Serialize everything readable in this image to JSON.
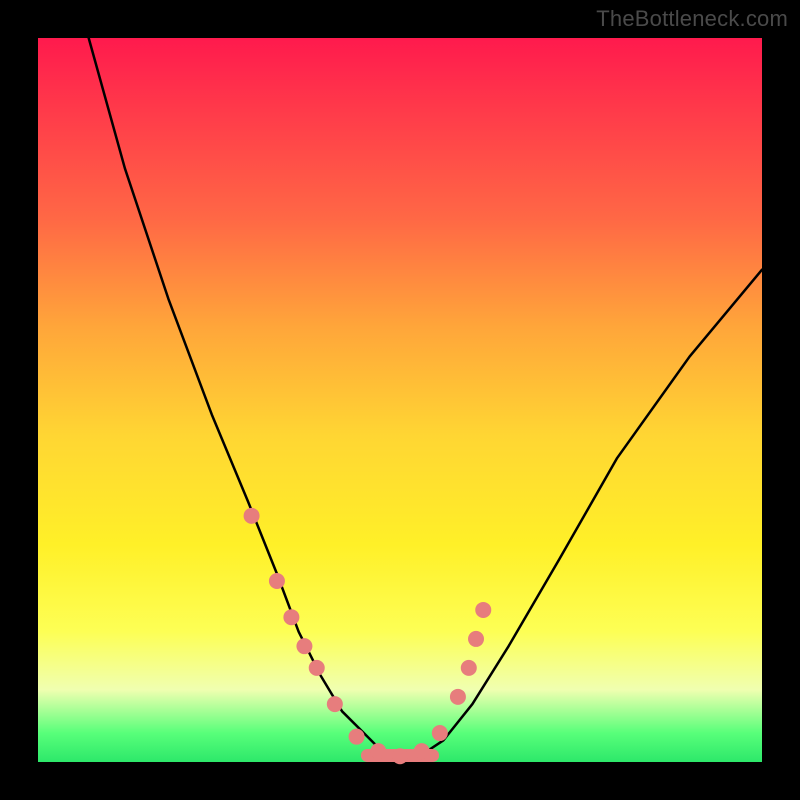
{
  "watermark": "TheBottleneck.com",
  "chart_data": {
    "type": "line",
    "title": "",
    "xlabel": "",
    "ylabel": "",
    "xlim": [
      0,
      100
    ],
    "ylim": [
      0,
      100
    ],
    "series": [
      {
        "name": "curve-left",
        "x": [
          7,
          12,
          18,
          24,
          29,
          33,
          36,
          39,
          42,
          45,
          47,
          49,
          51
        ],
        "y": [
          100,
          82,
          64,
          48,
          36,
          26,
          18,
          12,
          7,
          4,
          2,
          1,
          0.5
        ]
      },
      {
        "name": "curve-right",
        "x": [
          51,
          53,
          56,
          60,
          65,
          72,
          80,
          90,
          100
        ],
        "y": [
          0.5,
          1,
          3,
          8,
          16,
          28,
          42,
          56,
          68
        ]
      }
    ],
    "points": {
      "name": "markers",
      "x": [
        29.5,
        33,
        35,
        36.8,
        38.5,
        41,
        44,
        47,
        50,
        53,
        55.5,
        58,
        59.5,
        60.5,
        61.5
      ],
      "y": [
        34,
        25,
        20,
        16,
        13,
        8,
        3.5,
        1.5,
        0.8,
        1.5,
        4,
        9,
        13,
        17,
        21
      ]
    },
    "flat_bottom": {
      "x0": 45.5,
      "x1": 54.5,
      "y": 0.9
    },
    "marker_color": "#e77d7d",
    "curve_color": "#000000"
  }
}
